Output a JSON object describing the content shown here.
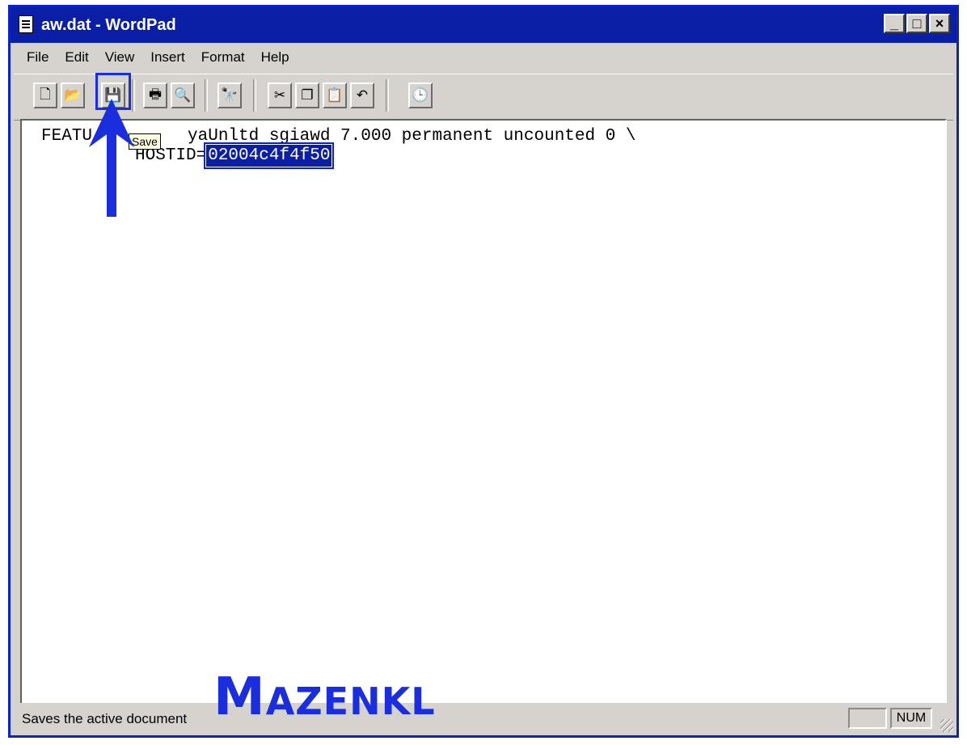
{
  "window": {
    "title": "aw.dat - WordPad",
    "caption_buttons": [
      "_",
      "□",
      "×"
    ]
  },
  "menu": [
    "File",
    "Edit",
    "View",
    "Insert",
    "Format",
    "Help"
  ],
  "toolbar": {
    "buttons": [
      {
        "name": "new-icon",
        "glyph": "🗋"
      },
      {
        "name": "open-icon",
        "glyph": "📂"
      },
      {
        "name": "save-icon",
        "glyph": "💾"
      },
      {
        "name": "print-icon",
        "glyph": "🖶"
      },
      {
        "name": "print-preview-icon",
        "glyph": "🔍"
      },
      {
        "name": "find-icon",
        "glyph": "🔭"
      },
      {
        "name": "cut-icon",
        "glyph": "✂"
      },
      {
        "name": "copy-icon",
        "glyph": "❐"
      },
      {
        "name": "paste-icon",
        "glyph": "📋"
      },
      {
        "name": "undo-icon",
        "glyph": "↶"
      },
      {
        "name": "date-time-icon",
        "glyph": "🕒"
      }
    ],
    "tooltip": "Save"
  },
  "document": {
    "line1_prefix": "FEATU",
    "line1_rest": "yaUnltd sgiawd 7.000 permanent uncounted 0 \\",
    "line2_prefix": "HOSTID=",
    "line2_selected": "02004c4f4f50"
  },
  "status": {
    "text": "Saves the active document",
    "num": "NUM"
  },
  "watermark": {
    "m": "M",
    "rest": "AZENKL"
  },
  "colors": {
    "accent": "#0b22c8",
    "titlebar": "#0a1ea6"
  }
}
